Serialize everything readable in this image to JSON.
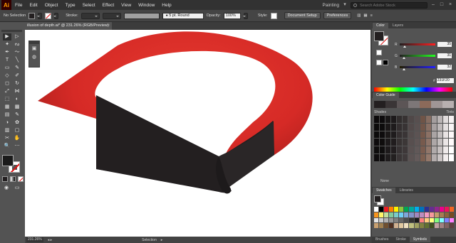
{
  "menubar": {
    "logo": "Ai",
    "items": [
      "File",
      "Edit",
      "Object",
      "Type",
      "Select",
      "Effect",
      "View",
      "Window",
      "Help"
    ],
    "workspace": "Painting",
    "search_placeholder": "Search Adobe Stock"
  },
  "controlbar": {
    "selection_label": "No Selection",
    "stroke_label": "Stroke:",
    "stroke_style": "5 pt. Round",
    "opacity_label": "Opacity:",
    "opacity_value": "100%",
    "style_label": "Style:",
    "doc_setup": "Document Setup",
    "preferences": "Preferences"
  },
  "document": {
    "tab_title": "illusion of depth.ai* @ 231.26% (RGB/Preview)",
    "zoom": "231.26%",
    "tool_status": "Selection"
  },
  "colors": {
    "red_shape": "#d62a26",
    "dark_side": "#231f20",
    "fill": "#231f20",
    "ui_bg": "#535353"
  },
  "color_panel": {
    "tabs": [
      "Color",
      "Layers"
    ],
    "r": "35",
    "g": "31",
    "b": "32",
    "r_frac": 0.137,
    "g_frac": 0.122,
    "b_frac": 0.125,
    "hex_label": "#",
    "hex": "231F20"
  },
  "guide_panel": {
    "title": "Color Guide",
    "shades": "Shades",
    "tints": "Tints",
    "none": "None"
  },
  "swatches_panel": {
    "tabs": [
      "Swatches",
      "Libraries"
    ],
    "bottom_tabs": [
      "Brushes",
      "Stroke",
      "Symbols"
    ]
  },
  "tools": [
    "selection-tool",
    "direct-selection-tool",
    "magic-wand-tool",
    "lasso-tool",
    "pen-tool",
    "curvature-tool",
    "type-tool",
    "line-segment-tool",
    "rectangle-tool",
    "paintbrush-tool",
    "shaper-tool",
    "pencil-tool",
    "eraser-tool",
    "rotate-tool",
    "scale-tool",
    "width-tool",
    "free-transform-tool",
    "shape-builder-tool",
    "perspective-grid-tool",
    "mesh-tool",
    "gradient-tool",
    "eyedropper-tool",
    "blend-tool",
    "symbol-sprayer-tool",
    "column-graph-tool",
    "artboard-tool",
    "slice-tool",
    "hand-tool",
    "zoom-tool",
    "more-tools"
  ]
}
